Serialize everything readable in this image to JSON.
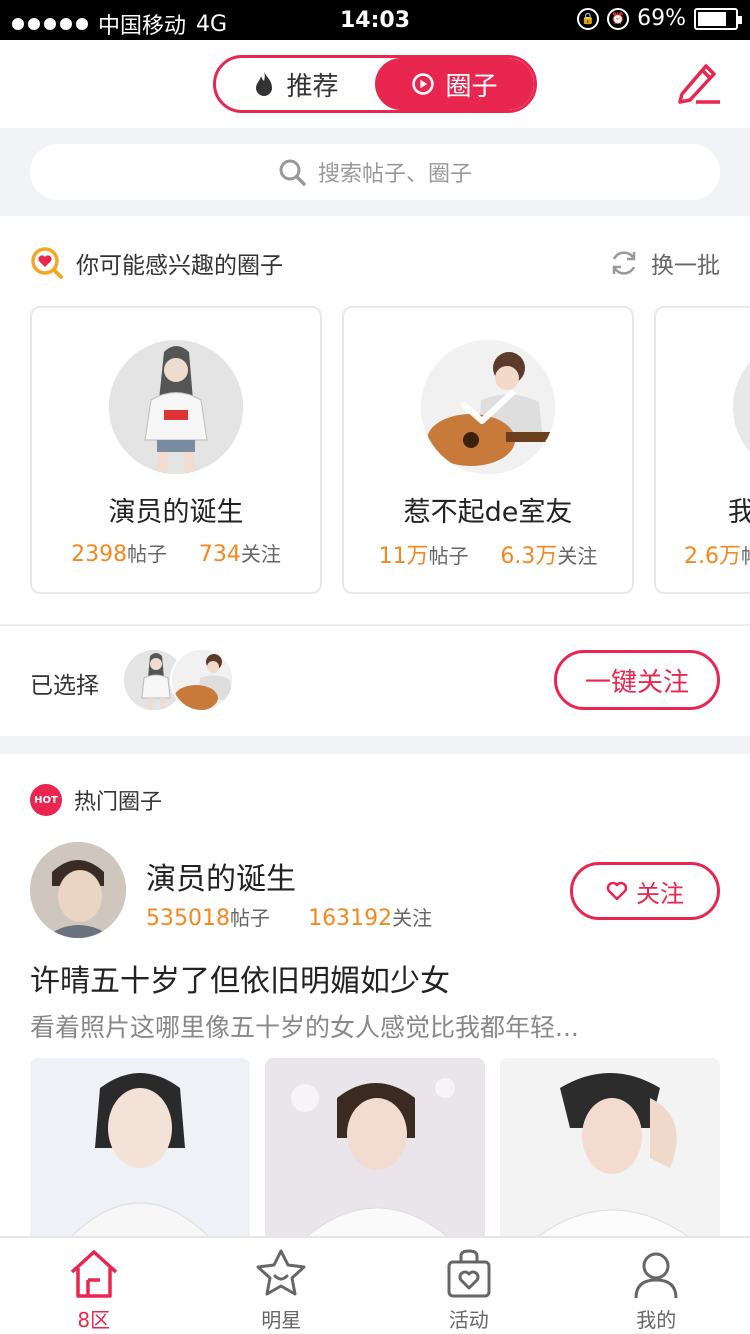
{
  "status_bar": {
    "carrier": "中国移动",
    "network": "4G",
    "time": "14:03",
    "battery": "69%",
    "battery_level": 0.69
  },
  "header": {
    "tabs": [
      {
        "label": "推荐",
        "icon": "flame-icon",
        "active": false
      },
      {
        "label": "圈子",
        "icon": "circle-play-icon",
        "active": true
      }
    ],
    "edit_icon": "pencil-icon"
  },
  "search": {
    "placeholder": "搜索帖子、圈子"
  },
  "interest": {
    "title": "你可能感兴趣的圈子",
    "refresh_label": "换一批",
    "cards": [
      {
        "name": "演员的诞生",
        "posts": "2398",
        "posts_unit": "帖子",
        "follows": "734",
        "follows_unit": "关注",
        "selected": false
      },
      {
        "name": "惹不起de室友",
        "posts": "11万",
        "posts_unit": "帖子",
        "follows": "6.3万",
        "follows_unit": "关注",
        "selected": true
      },
      {
        "name": "我",
        "posts": "2.6万",
        "posts_unit": "帖子",
        "follows": "",
        "follows_unit": "",
        "selected": false
      }
    ]
  },
  "selected": {
    "label": "已选择",
    "follow_all_label": "一键关注"
  },
  "hot": {
    "badge": "HOT",
    "title": "热门圈子",
    "post": {
      "circle_name": "演员的诞生",
      "posts": "535018",
      "posts_unit": "帖子",
      "follows": "163192",
      "follows_unit": "关注",
      "follow_label": "关注",
      "title": "许晴五十岁了但依旧明媚如少女",
      "description": "看着照片这哪里像五十岁的女人感觉比我都年轻..."
    }
  },
  "tabbar": [
    {
      "label": "8区",
      "icon": "home-icon",
      "active": true
    },
    {
      "label": "明星",
      "icon": "star-icon",
      "active": false
    },
    {
      "label": "活动",
      "icon": "bag-icon",
      "active": false
    },
    {
      "label": "我的",
      "icon": "person-icon",
      "active": false
    }
  ],
  "colors": {
    "accent": "#e8264f",
    "number": "#f5871f"
  }
}
